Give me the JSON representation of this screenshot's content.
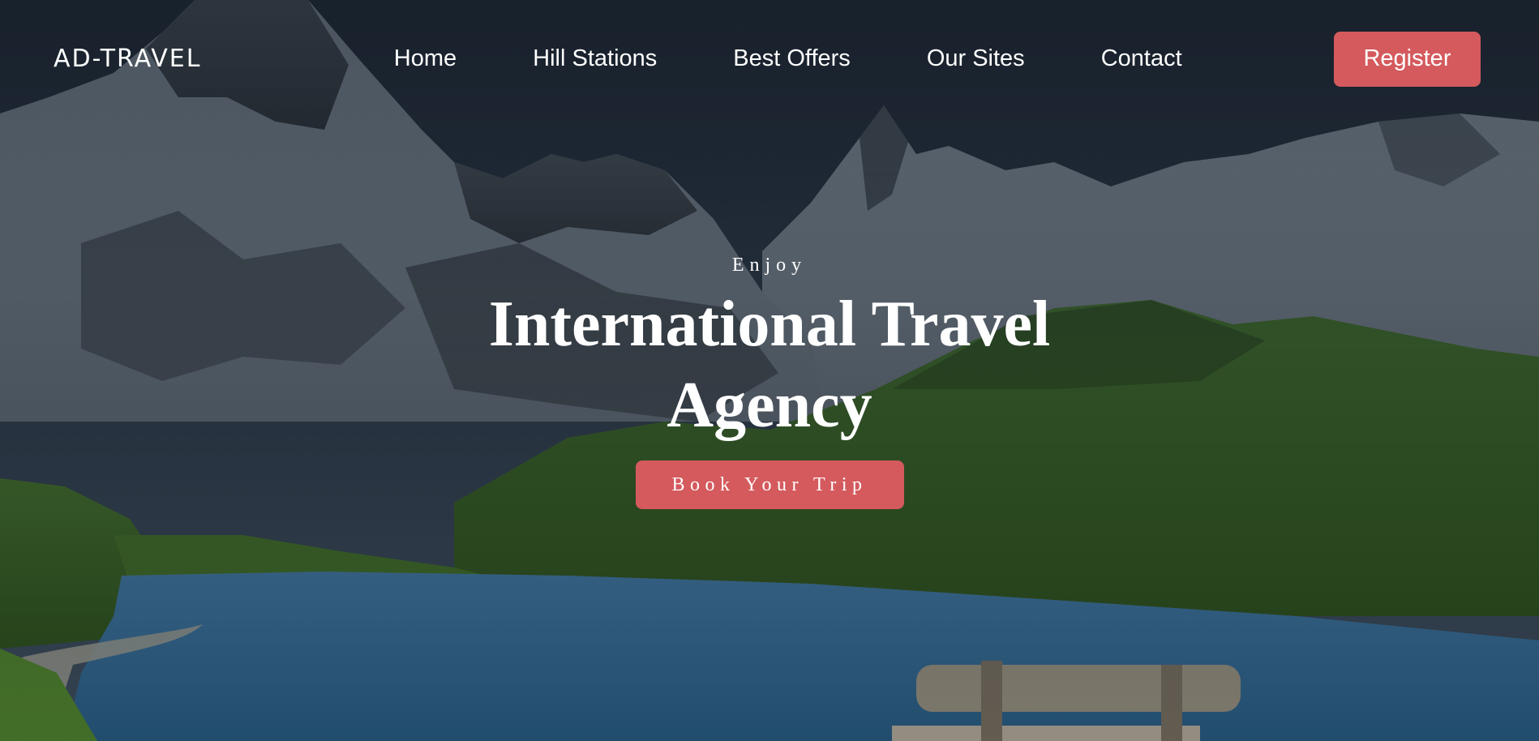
{
  "nav": {
    "brand": "AD-TRAVEL",
    "links": [
      "Home",
      "Hill Stations",
      "Best Offers",
      "Our Sites",
      "Contact"
    ],
    "register_label": "Register"
  },
  "hero": {
    "tagline": "Enjoy",
    "headline": "International Travel Agency",
    "cta_label": "Book Your Trip",
    "background": "mountain-lake-landscape"
  },
  "colors": {
    "accent": "#d45a5d",
    "text": "#ffffff"
  }
}
